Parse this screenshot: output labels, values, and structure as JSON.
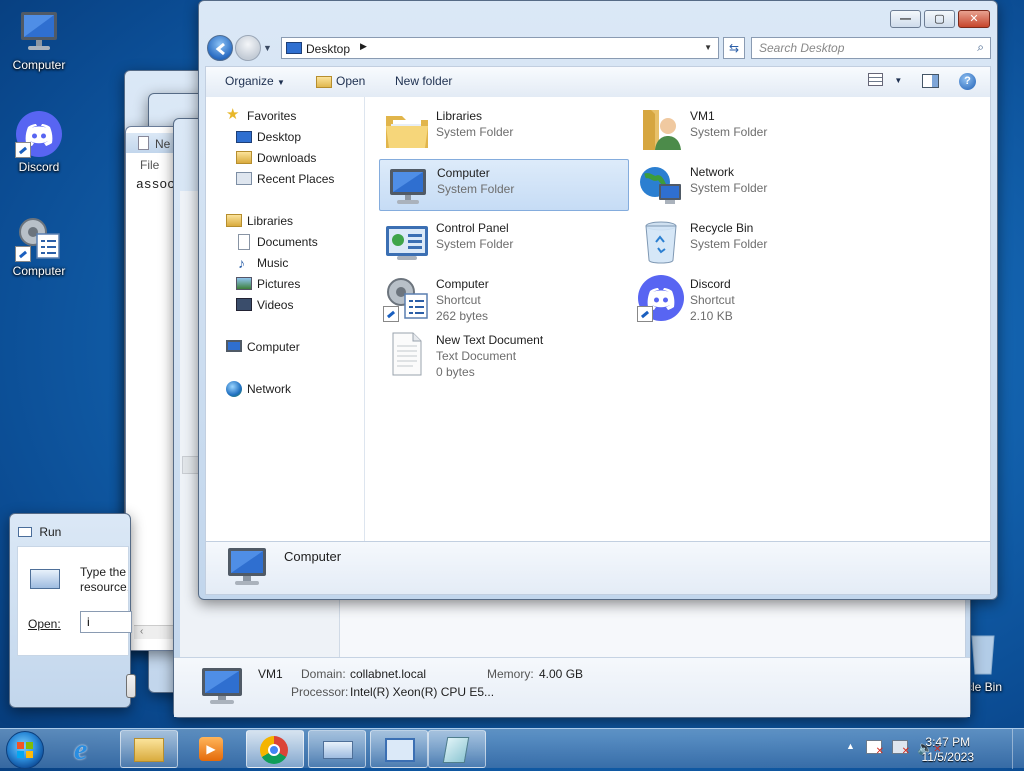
{
  "desktop": {
    "icons": [
      {
        "label": "Computer"
      },
      {
        "label": "Discord"
      },
      {
        "label": "Computer"
      },
      {
        "label": "cle Bin"
      }
    ]
  },
  "back_windows": {
    "notepad": {
      "title": "Ne",
      "menu": "File",
      "text": "assoc"
    },
    "vm": {
      "name": "VM1",
      "domain_label": "Domain:",
      "domain_value": "collabnet.local",
      "memory_label": "Memory:",
      "memory_value": "4.00 GB",
      "processor_label": "Processor:",
      "processor_value": "Intel(R) Xeon(R) CPU E5..."
    }
  },
  "run_dialog": {
    "title": "Run",
    "desc": "Type the resource,",
    "open_label": "Open:",
    "open_value": "i"
  },
  "explorer": {
    "breadcrumb": "Desktop",
    "search_placeholder": "Search Desktop",
    "toolbar": {
      "organize": "Organize",
      "open": "Open",
      "new_folder": "New folder"
    },
    "nav": {
      "favorites": "Favorites",
      "fav_items": [
        "Desktop",
        "Downloads",
        "Recent Places"
      ],
      "libraries": "Libraries",
      "lib_items": [
        "Documents",
        "Music",
        "Pictures",
        "Videos"
      ],
      "computer": "Computer",
      "network": "Network"
    },
    "items": [
      {
        "name": "Libraries",
        "type": "System Folder",
        "size": ""
      },
      {
        "name": "VM1",
        "type": "System Folder",
        "size": ""
      },
      {
        "name": "Computer",
        "type": "System Folder",
        "size": ""
      },
      {
        "name": "Network",
        "type": "System Folder",
        "size": ""
      },
      {
        "name": "Control Panel",
        "type": "System Folder",
        "size": ""
      },
      {
        "name": "Recycle Bin",
        "type": "System Folder",
        "size": ""
      },
      {
        "name": "Computer",
        "type": "Shortcut",
        "size": "262 bytes"
      },
      {
        "name": "Discord",
        "type": "Shortcut",
        "size": "2.10 KB"
      },
      {
        "name": "New Text Document",
        "type": "Text Document",
        "size": "0 bytes"
      }
    ],
    "details_name": "Computer"
  },
  "taskbar": {
    "time": "3:47 PM",
    "date": "11/5/2023"
  }
}
